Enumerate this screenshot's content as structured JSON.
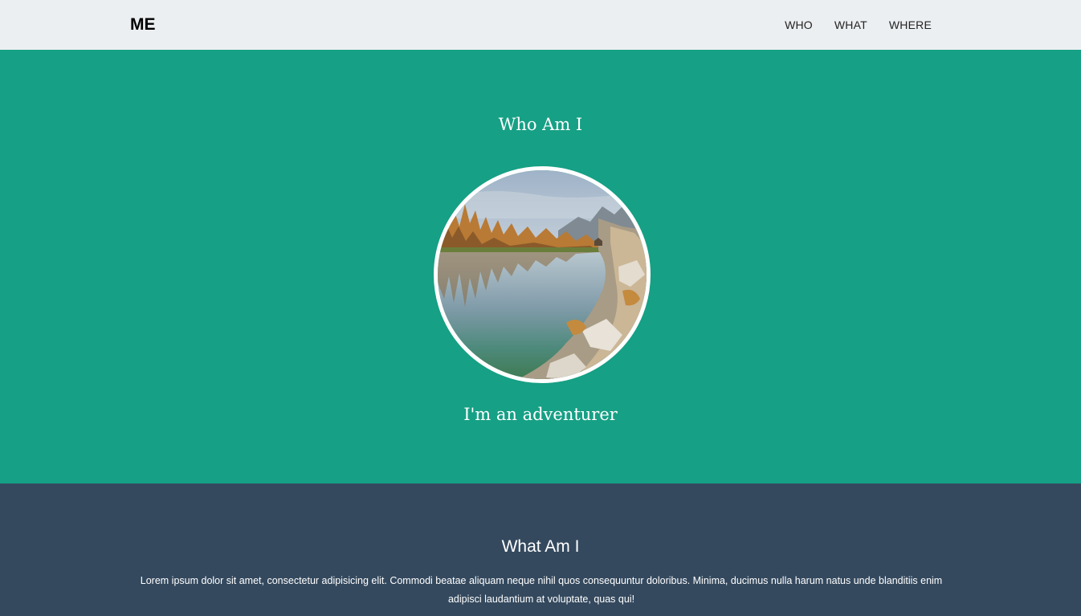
{
  "nav": {
    "brand": "ME",
    "links": [
      "WHO",
      "WHAT",
      "WHERE"
    ]
  },
  "who": {
    "title": "Who Am I",
    "tagline": "I'm an adventurer",
    "image_icon": "landscape-lake-photo"
  },
  "what": {
    "title": "What Am I",
    "text": "Lorem ipsum dolor sit amet, consectetur adipisicing elit. Commodi beatae aliquam neque nihil quos consequuntur doloribus. Minima, ducimus nulla harum natus unde blanditiis enim adipisci laudantium at voluptate, quas qui!"
  },
  "colors": {
    "navbar_bg": "#eceff1",
    "who_bg": "#16a085",
    "what_bg": "#34495e",
    "text_light": "#ffffff"
  }
}
